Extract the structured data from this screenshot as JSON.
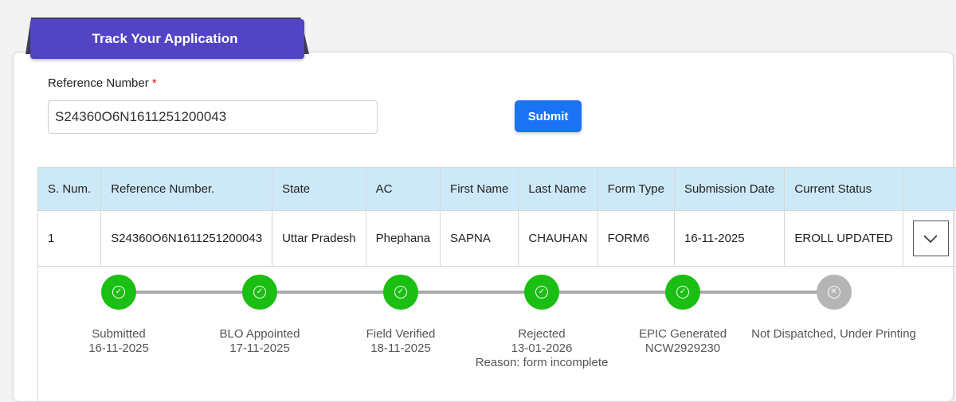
{
  "tab": {
    "title": "Track Your Application"
  },
  "form": {
    "label": "Reference Number",
    "required_mark": "*",
    "value": "S24360O6N1611251200043",
    "submit_label": "Submit"
  },
  "table": {
    "headers": [
      "S. Num.",
      "Reference Number.",
      "State",
      "AC",
      "First Name",
      "Last Name",
      "Form Type",
      "Submission Date",
      "Current Status",
      ""
    ],
    "rows": [
      [
        "1",
        "S24360O6N1611251200043",
        "Uttar Pradesh",
        "Phephana",
        "SAPNA",
        "CHAUHAN",
        "FORM6",
        "16-11-2025",
        "EROLL UPDATED"
      ]
    ]
  },
  "steps": [
    {
      "title": "Submitted",
      "date": "16-11-2025",
      "note": "",
      "state": "done",
      "icon": "check-icon"
    },
    {
      "title": "BLO Appointed",
      "date": "17-11-2025",
      "note": "",
      "state": "done",
      "icon": "check-icon"
    },
    {
      "title": "Field Verified",
      "date": "18-11-2025",
      "note": "",
      "state": "done",
      "icon": "check-icon"
    },
    {
      "title": "Rejected",
      "date": "13-01-2026",
      "note": "Reason: form incomplete",
      "state": "done",
      "icon": "check-icon"
    },
    {
      "title": "EPIC Generated",
      "date": "NCW2929230",
      "note": "",
      "state": "done",
      "icon": "check-icon"
    },
    {
      "title": "Not Dispatched, Under Printing",
      "date": "",
      "note": "",
      "state": "pending",
      "icon": "cross-icon"
    }
  ],
  "colors": {
    "tab": "#5344c6",
    "submit": "#1a73f5",
    "header": "#cde9f8",
    "done": "#1bbe12",
    "pending": "#b5b5b5"
  }
}
